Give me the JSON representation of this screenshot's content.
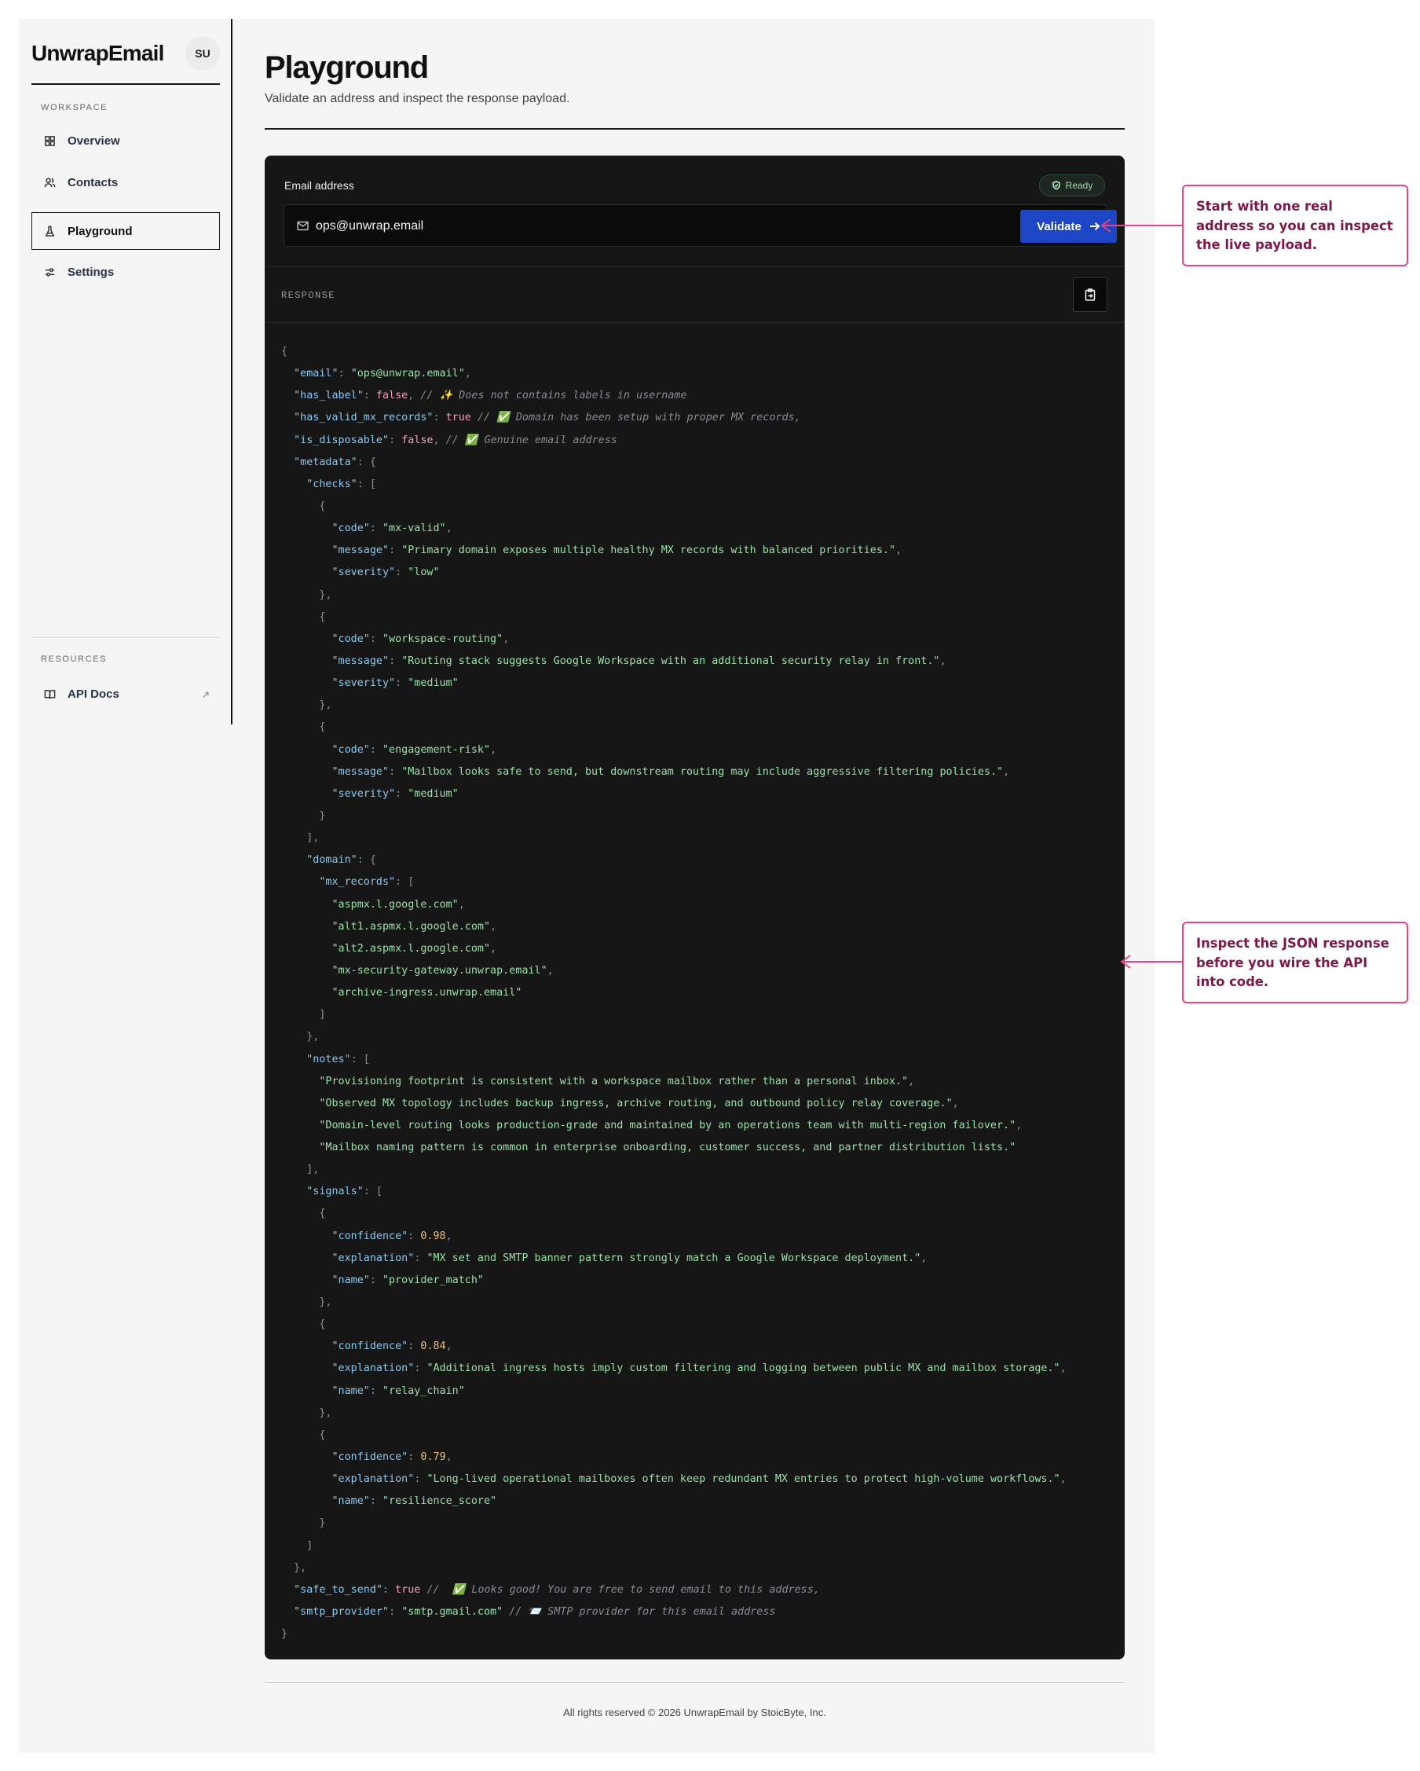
{
  "sidebar": {
    "brand": "UnwrapEmail",
    "avatar": "SU",
    "workspace_label": "WORKSPACE",
    "items": [
      {
        "label": "Overview",
        "icon": "grid-icon"
      },
      {
        "label": "Contacts",
        "icon": "users-icon"
      },
      {
        "label": "Playground",
        "icon": "flask-icon"
      },
      {
        "label": "Settings",
        "icon": "sliders-icon"
      }
    ],
    "resources_label": "RESOURCES",
    "resources": [
      {
        "label": "API Docs",
        "icon": "book-icon",
        "external_icon": "↗"
      }
    ]
  },
  "main": {
    "title": "Playground",
    "subtitle": "Validate an address and inspect the response payload.",
    "email_label": "Email address",
    "status_badge": "Ready",
    "email_value": "ops@unwrap.email",
    "validate_label": "Validate",
    "response_label": "RESPONSE",
    "footer": "All rights reserved © 2026 UnwrapEmail by StoicByte, Inc."
  },
  "response": {
    "email": "ops@unwrap.email",
    "has_label": false,
    "has_label_comment": "✨ Does not contains labels in username",
    "has_valid_mx_records": true,
    "has_valid_mx_records_comment": "✅ Domain has been setup with proper MX records,",
    "is_disposable": false,
    "is_disposable_comment": "✅ Genuine email address",
    "metadata": {
      "checks": [
        {
          "code": "mx-valid",
          "message": "Primary domain exposes multiple healthy MX records with balanced priorities.",
          "severity": "low"
        },
        {
          "code": "workspace-routing",
          "message": "Routing stack suggests Google Workspace with an additional security relay in front.",
          "severity": "medium"
        },
        {
          "code": "engagement-risk",
          "message": "Mailbox looks safe to send, but downstream routing may include aggressive filtering policies.",
          "severity": "medium"
        }
      ],
      "domain": {
        "mx_records": [
          "aspmx.l.google.com",
          "alt1.aspmx.l.google.com",
          "alt2.aspmx.l.google.com",
          "mx-security-gateway.unwrap.email",
          "archive-ingress.unwrap.email"
        ]
      },
      "notes": [
        "Provisioning footprint is consistent with a workspace mailbox rather than a personal inbox.",
        "Observed MX topology includes backup ingress, archive routing, and outbound policy relay coverage.",
        "Domain-level routing looks production-grade and maintained by an operations team with multi-region failover.",
        "Mailbox naming pattern is common in enterprise onboarding, customer success, and partner distribution lists."
      ],
      "signals": [
        {
          "confidence": 0.98,
          "explanation": "MX set and SMTP banner pattern strongly match a Google Workspace deployment.",
          "name": "provider_match"
        },
        {
          "confidence": 0.84,
          "explanation": "Additional ingress hosts imply custom filtering and logging between public MX and mailbox storage.",
          "name": "relay_chain"
        },
        {
          "confidence": 0.79,
          "explanation": "Long-lived operational mailboxes often keep redundant MX entries to protect high-volume workflows.",
          "name": "resilience_score"
        }
      ]
    },
    "safe_to_send": true,
    "safe_to_send_comment": " ✅ Looks good! You are free to send email to this address,",
    "smtp_provider": "smtp.gmail.com",
    "smtp_provider_comment": "📨 SMTP provider for this email address"
  },
  "callouts": [
    {
      "text": "Start with one real address so you can inspect the live payload."
    },
    {
      "text": "Inspect the JSON response before you wire the API into code."
    }
  ],
  "colors": {
    "accent": "#1c46c6",
    "callout_border": "#e0468a",
    "callout_text": "#7a1a48",
    "json_key": "#8cc8ec",
    "json_string": "#9ae0a8",
    "json_boolean": "#f0a0b8",
    "json_number": "#f0c070"
  }
}
